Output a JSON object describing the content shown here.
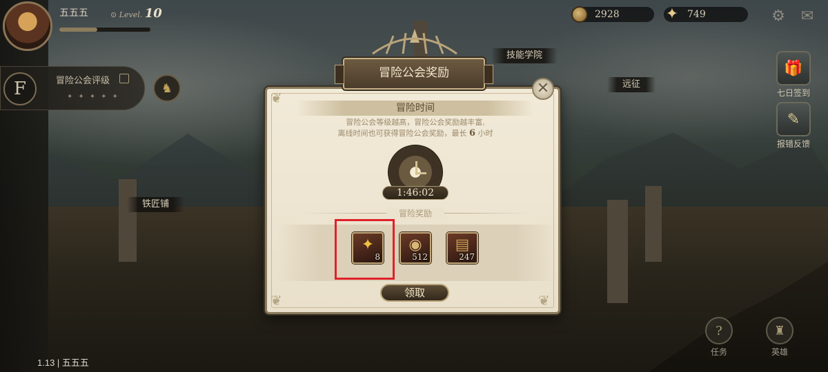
{
  "player": {
    "name": "五五五",
    "level_prefix": "Level.",
    "level": "10"
  },
  "resources": {
    "coins": "2928",
    "gems": "749"
  },
  "guild_panel": {
    "rank": "F",
    "label": "冒险公会评级"
  },
  "map_labels": {
    "skill_academy": "技能学院",
    "expedition": "远征",
    "blacksmith": "铁匠铺"
  },
  "side_buttons": {
    "seven_day_checkin": "七日签到",
    "bug_report": "报错反馈"
  },
  "bottom_buttons": {
    "tasks": "任务",
    "heroes": "英雄"
  },
  "version": "1.13 | 五五五",
  "dialog": {
    "title": "冒险公会奖励",
    "section_title": "冒险时间",
    "desc_line1": "冒险公会等级越高，冒险公会奖励越丰富,",
    "desc_line2_prefix": "离线时间也可获得冒险公会奖励，最长",
    "desc_hours": "6",
    "desc_line2_suffix": "小时",
    "timer": "1:46:02",
    "rewards_label": "冒险奖励",
    "rewards": [
      {
        "icon": "gold-star-icon",
        "count": "8",
        "color": "#f0c040"
      },
      {
        "icon": "coin-icon",
        "count": "512",
        "color": "#d8b777"
      },
      {
        "icon": "book-icon",
        "count": "247",
        "color": "#c9a055"
      }
    ],
    "claim_label": "领取",
    "highlight_color": "#e0202a"
  }
}
